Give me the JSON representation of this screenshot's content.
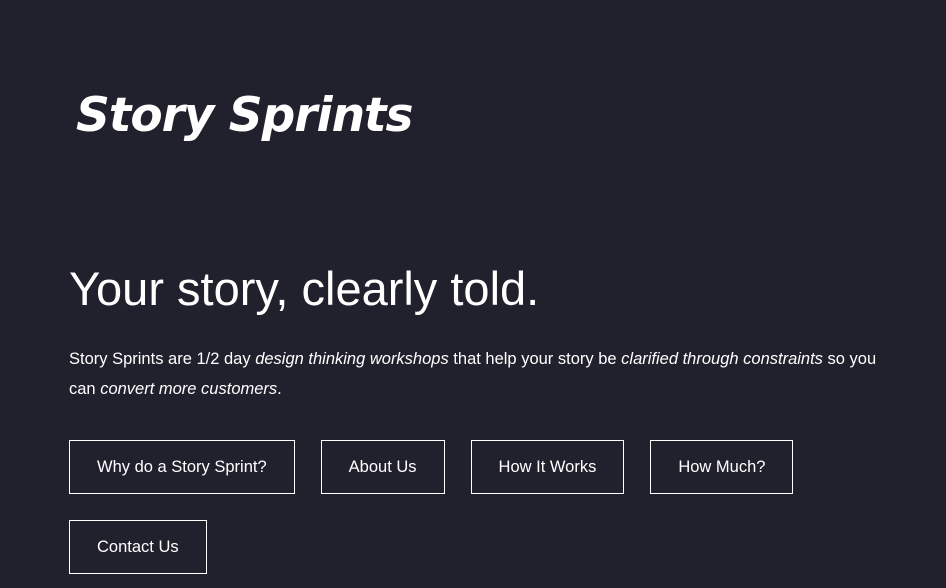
{
  "brand": {
    "logo_text": "Story Sprints"
  },
  "hero": {
    "headline": "Your story, clearly told.",
    "intro": {
      "part1": "Story Sprints are 1/2 day ",
      "em1": "design thinking workshops",
      "part2": " that help your story be ",
      "em2": "clarified through constraints",
      "part3": " so you can ",
      "em3": "convert more customers",
      "part4": "."
    }
  },
  "nav": {
    "buttons": [
      {
        "label": "Why do a Story Sprint?"
      },
      {
        "label": "About Us"
      },
      {
        "label": "How It Works"
      },
      {
        "label": "How Much?"
      },
      {
        "label": "Contact Us"
      }
    ]
  },
  "colors": {
    "background": "#21212d",
    "text": "#ffffff",
    "button_border": "#ffffff"
  }
}
